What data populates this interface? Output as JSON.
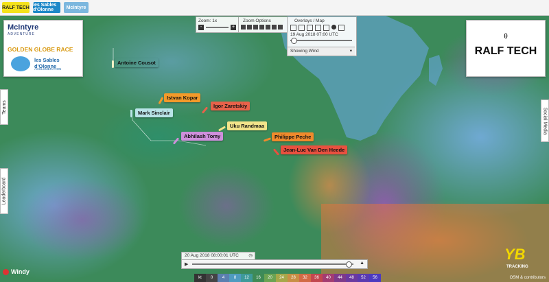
{
  "topbar": {
    "logos": [
      "RALF TECH",
      "les Sables d'Olonne",
      "McIntyre"
    ]
  },
  "zoom": {
    "label": "Zoom: 1x",
    "minus": "-",
    "plus": "+"
  },
  "zoom_options": {
    "label": "Zoom Options"
  },
  "overlays": {
    "label": "Overlays / Map",
    "date": "19 Aug 2018 07:00 UTC",
    "showing": "Showing Wind"
  },
  "race_logo": {
    "brand": "McIntyre",
    "brand_sub": "ADVENTURE",
    "race": "GOLDEN GLOBE RACE",
    "partner": "les Sables d'Olonne",
    "partner_sub": "AGGLOMERATION"
  },
  "sponsor_logo": {
    "name": "RALF TECH"
  },
  "sidetabs": {
    "teams": "Teams",
    "leaderboard": "Leaderboard",
    "social": "Social Media"
  },
  "boats": [
    {
      "name": "Antoine Cousot",
      "color": "#f7f3c8"
    },
    {
      "name": "Istvan Kopar",
      "color": "#f39a2a"
    },
    {
      "name": "Igor Zaretskiy",
      "color": "#e8624a"
    },
    {
      "name": "Mark Sinclair",
      "color": "#b9e4e8"
    },
    {
      "name": "Uku Randmaa",
      "color": "#f2e48a"
    },
    {
      "name": "Abhilash Tomy",
      "color": "#cf8fdc"
    },
    {
      "name": "Philippe Peche",
      "color": "#f08a2c"
    },
    {
      "name": "Jean-Luc Van Den Heede",
      "color": "#e9503f"
    }
  ],
  "timeline": {
    "time": "20 Aug 2018 08:00:01 UTC",
    "progress": 0.97
  },
  "windy": {
    "label": "Windy"
  },
  "tracking": {
    "label": "TRACKING",
    "credit": "OSM & contributors"
  },
  "legend": {
    "unit": "kt",
    "values": [
      "0",
      "4",
      "8",
      "12",
      "16",
      "20",
      "24",
      "28",
      "32",
      "36",
      "40",
      "44",
      "48",
      "52",
      "56"
    ]
  }
}
